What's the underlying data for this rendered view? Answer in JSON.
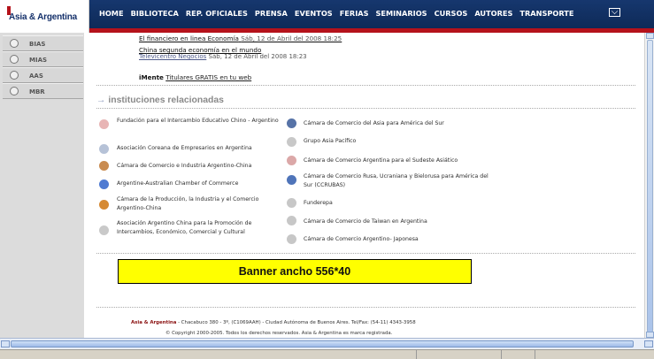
{
  "logo": {
    "text": "Asia & Argentina"
  },
  "nav": [
    "HOME",
    "BIBLIOTECA",
    "REP. OFICIALES",
    "PRENSA",
    "EVENTOS",
    "FERIAS",
    "SEMINARIOS",
    "CURSOS",
    "AUTORES",
    "TRANSPORTE"
  ],
  "sidebar": [
    "BIAS",
    "MIAS",
    "AAS",
    "MBR"
  ],
  "news": {
    "item1_title": "El financiero en linea Economía",
    "item1_date": "Sáb, 12 de Abril del 2008 18:25",
    "item2_title": "China segunda economía en el mundo",
    "item2_source": "Televicentro Negocios",
    "item2_date": "Sáb, 12 de Abril del 2008 18:23",
    "imente_name": "iMente",
    "imente_link": "Titulares GRATIS en tu web"
  },
  "section": {
    "heading": "instituciones relacionadas"
  },
  "institutions_left": [
    "Fundación para el Intercambio Educativo Chino - Argentino",
    "Asociación Coreana de Empresarios en Argentina",
    "Cámara de Comercio e Industria Argentino-China",
    "Argentine-Australian Chamber of Commerce",
    "Cámara de la Producción, la Industria y el Comercio Argentino-China",
    "Asociación Argentino China para la Promoción de Intercambios, Económico, Comercial y Cultural"
  ],
  "institutions_right": [
    "Cámara de Comercio del Asia para América del Sur",
    "Grupo Asia Pacífico",
    "Cámara de Comercio Argentina para el Sudeste Asiático",
    "Cámara de Comercio Rusa, Ucraniana y Bielorusa para América del Sur (CCRUBAS)",
    "Funderepa",
    "Cámara de Comercio de Taiwan en Argentina",
    "Cámara de Comercio Argentino- Japonesa"
  ],
  "banner": {
    "text": "Banner ancho 556*40"
  },
  "footer": {
    "brand": "Asia & Argentina",
    "address": " - Chacabuco 380 - 3º, (C1069AAH) - Ciudad Autónoma de Buenos Aires. Tel/Fax: (54-11) 4343-3958",
    "copyright": "© Copyright 2000-2005. Todos los derechos reservados. Asia & Argentina es marca registrada."
  }
}
